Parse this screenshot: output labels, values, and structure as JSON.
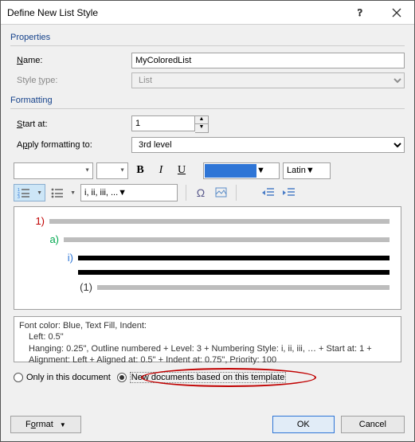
{
  "title": "Define New List Style",
  "properties": {
    "section_label": "Properties",
    "name_label": "Name:",
    "name_value": "MyColoredList",
    "style_type_label": "Style type:",
    "style_type_value": "List"
  },
  "formatting": {
    "section_label": "Formatting",
    "start_at_label": "Start at:",
    "start_at_value": "1",
    "apply_to_label": "Apply formatting to:",
    "apply_to_value": "3rd level",
    "font_name": "",
    "font_size": "",
    "bold": "B",
    "italic": "I",
    "underline": "U",
    "color_hex": "#2e75d6",
    "script_value": "Latin",
    "numformat_value": "i, ii, iii, ...",
    "omega": "Ω"
  },
  "preview_levels": [
    {
      "label": "1)",
      "color": "#c00000",
      "indent": 0,
      "line": "gray"
    },
    {
      "label": "a)",
      "color": "#00a84f",
      "indent": 18,
      "line": "gray"
    },
    {
      "label": "i)",
      "color": "#2e75d6",
      "indent": 36,
      "line": "black"
    },
    {
      "label": "",
      "color": "#000000",
      "indent": 36,
      "line": "black"
    },
    {
      "label": "(1)",
      "color": "#333333",
      "indent": 54,
      "line": "gray"
    }
  ],
  "description": {
    "line1": "Font color: Blue, Text Fill, Indent:",
    "line2": "Left:  0.5\"",
    "line3": "Hanging:  0.25\", Outline numbered + Level: 3 + Numbering Style: i, ii, iii, … + Start at: 1 + Alignment: Left + Aligned at:  0.5\" + Indent at:  0.75\", Priority: 100"
  },
  "scope": {
    "only_doc_label": "Only in this document",
    "new_docs_label": "New documents based on this template",
    "selected": "new_docs"
  },
  "footer": {
    "format_label": "Format",
    "ok_label": "OK",
    "cancel_label": "Cancel"
  }
}
